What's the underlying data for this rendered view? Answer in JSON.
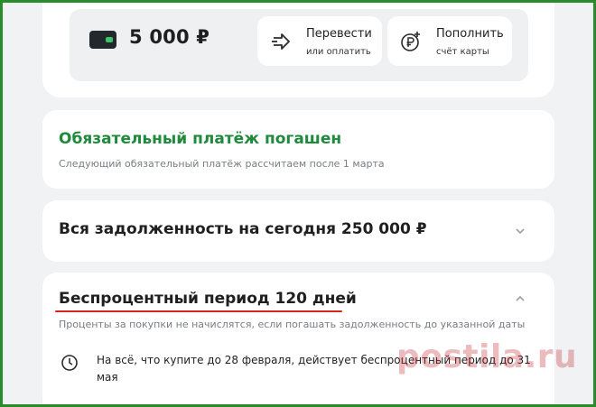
{
  "balance": {
    "amount": "5 000 ₽",
    "card_icon": "card-icon"
  },
  "actions": [
    {
      "label": "Перевести",
      "sub": "или оплатить",
      "icon": "transfer-arrow-icon"
    },
    {
      "label": "Пополнить",
      "sub": "счёт карты",
      "icon": "ruble-plus-icon"
    }
  ],
  "payment": {
    "title": "Обязательный платёж погашен",
    "description": "Следующий обязательный платёж рассчитаем после 1 марта"
  },
  "debt": {
    "title": "Вся задолженность на сегодня 250 000 ₽",
    "icon": "chevron-down-icon"
  },
  "grace_period": {
    "title": "Беспроцентный период 120 дней",
    "description": "Проценты за покупки не начислятся, если погашать задолженность до указанной даты",
    "info": "На всё, что купите до 28 февраля, действует беспроцентный период до 31 мая",
    "icon": "chevron-up-icon",
    "info_icon": "clock-icon"
  },
  "watermark": "postila.ru",
  "colors": {
    "frame": "#2a8b2a",
    "accent_green": "#1f8a3c",
    "underline_red": "#d9231d",
    "background": "#f1f2f4"
  }
}
